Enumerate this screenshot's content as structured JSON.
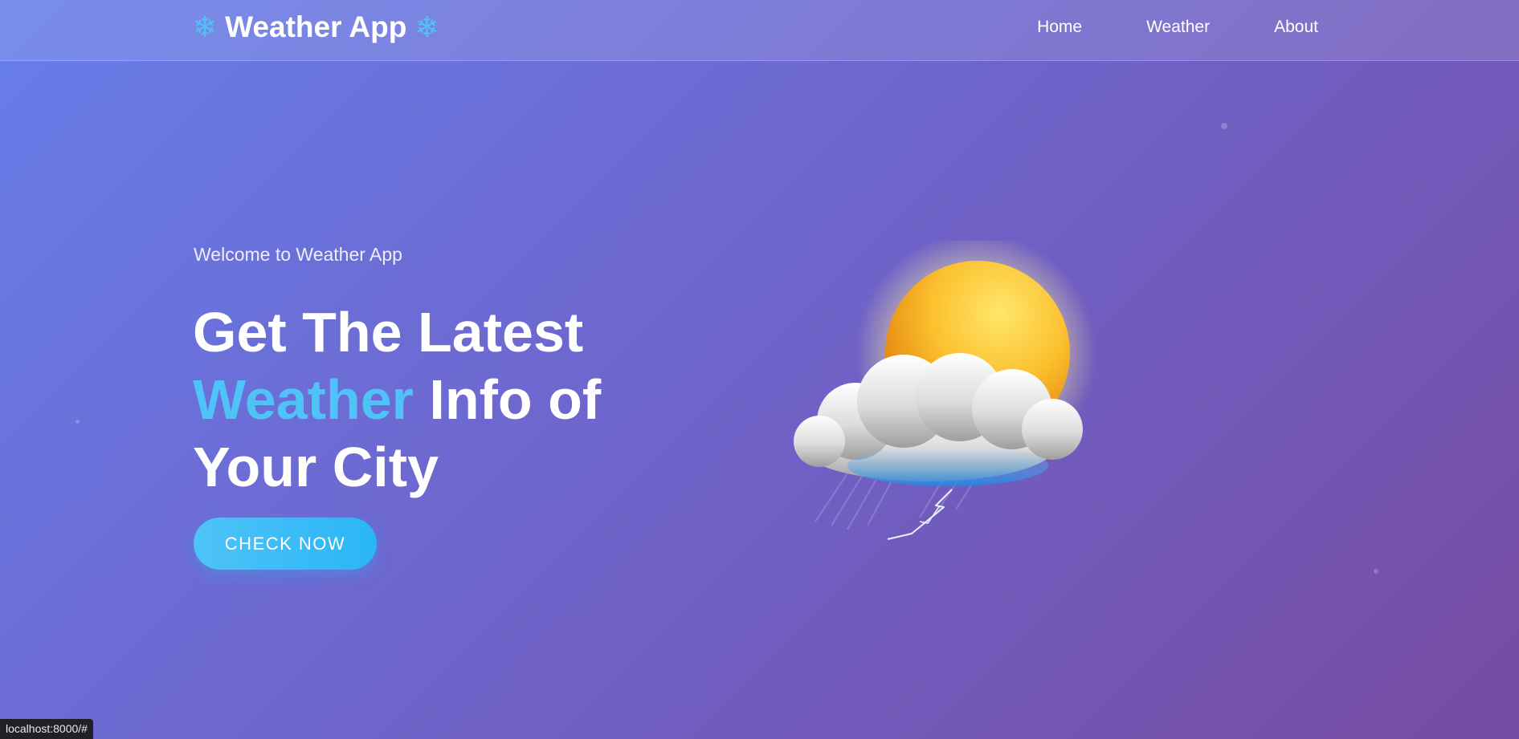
{
  "navbar": {
    "brand_icon_left": "❄",
    "brand_title": "Weather App",
    "brand_icon_right": "❄",
    "links": [
      {
        "label": "Home"
      },
      {
        "label": "Weather"
      },
      {
        "label": "About"
      }
    ]
  },
  "hero": {
    "subtitle": "Welcome to Weather App",
    "title_line1": "Get The Latest",
    "title_line2_accent": "Weather",
    "title_line2_rest": " Info of",
    "title_line3": "Your City",
    "cta_label": "CHECK NOW"
  },
  "status_bar": {
    "url": "localhost:8000/#"
  },
  "colors": {
    "accent": "#4fc3f7",
    "gradient_start": "#667eea",
    "gradient_end": "#764ba2",
    "text": "#ffffff"
  },
  "icons": {
    "brand": "snowflake-icon",
    "illustration": "sun-behind-storm-cloud-icon"
  }
}
